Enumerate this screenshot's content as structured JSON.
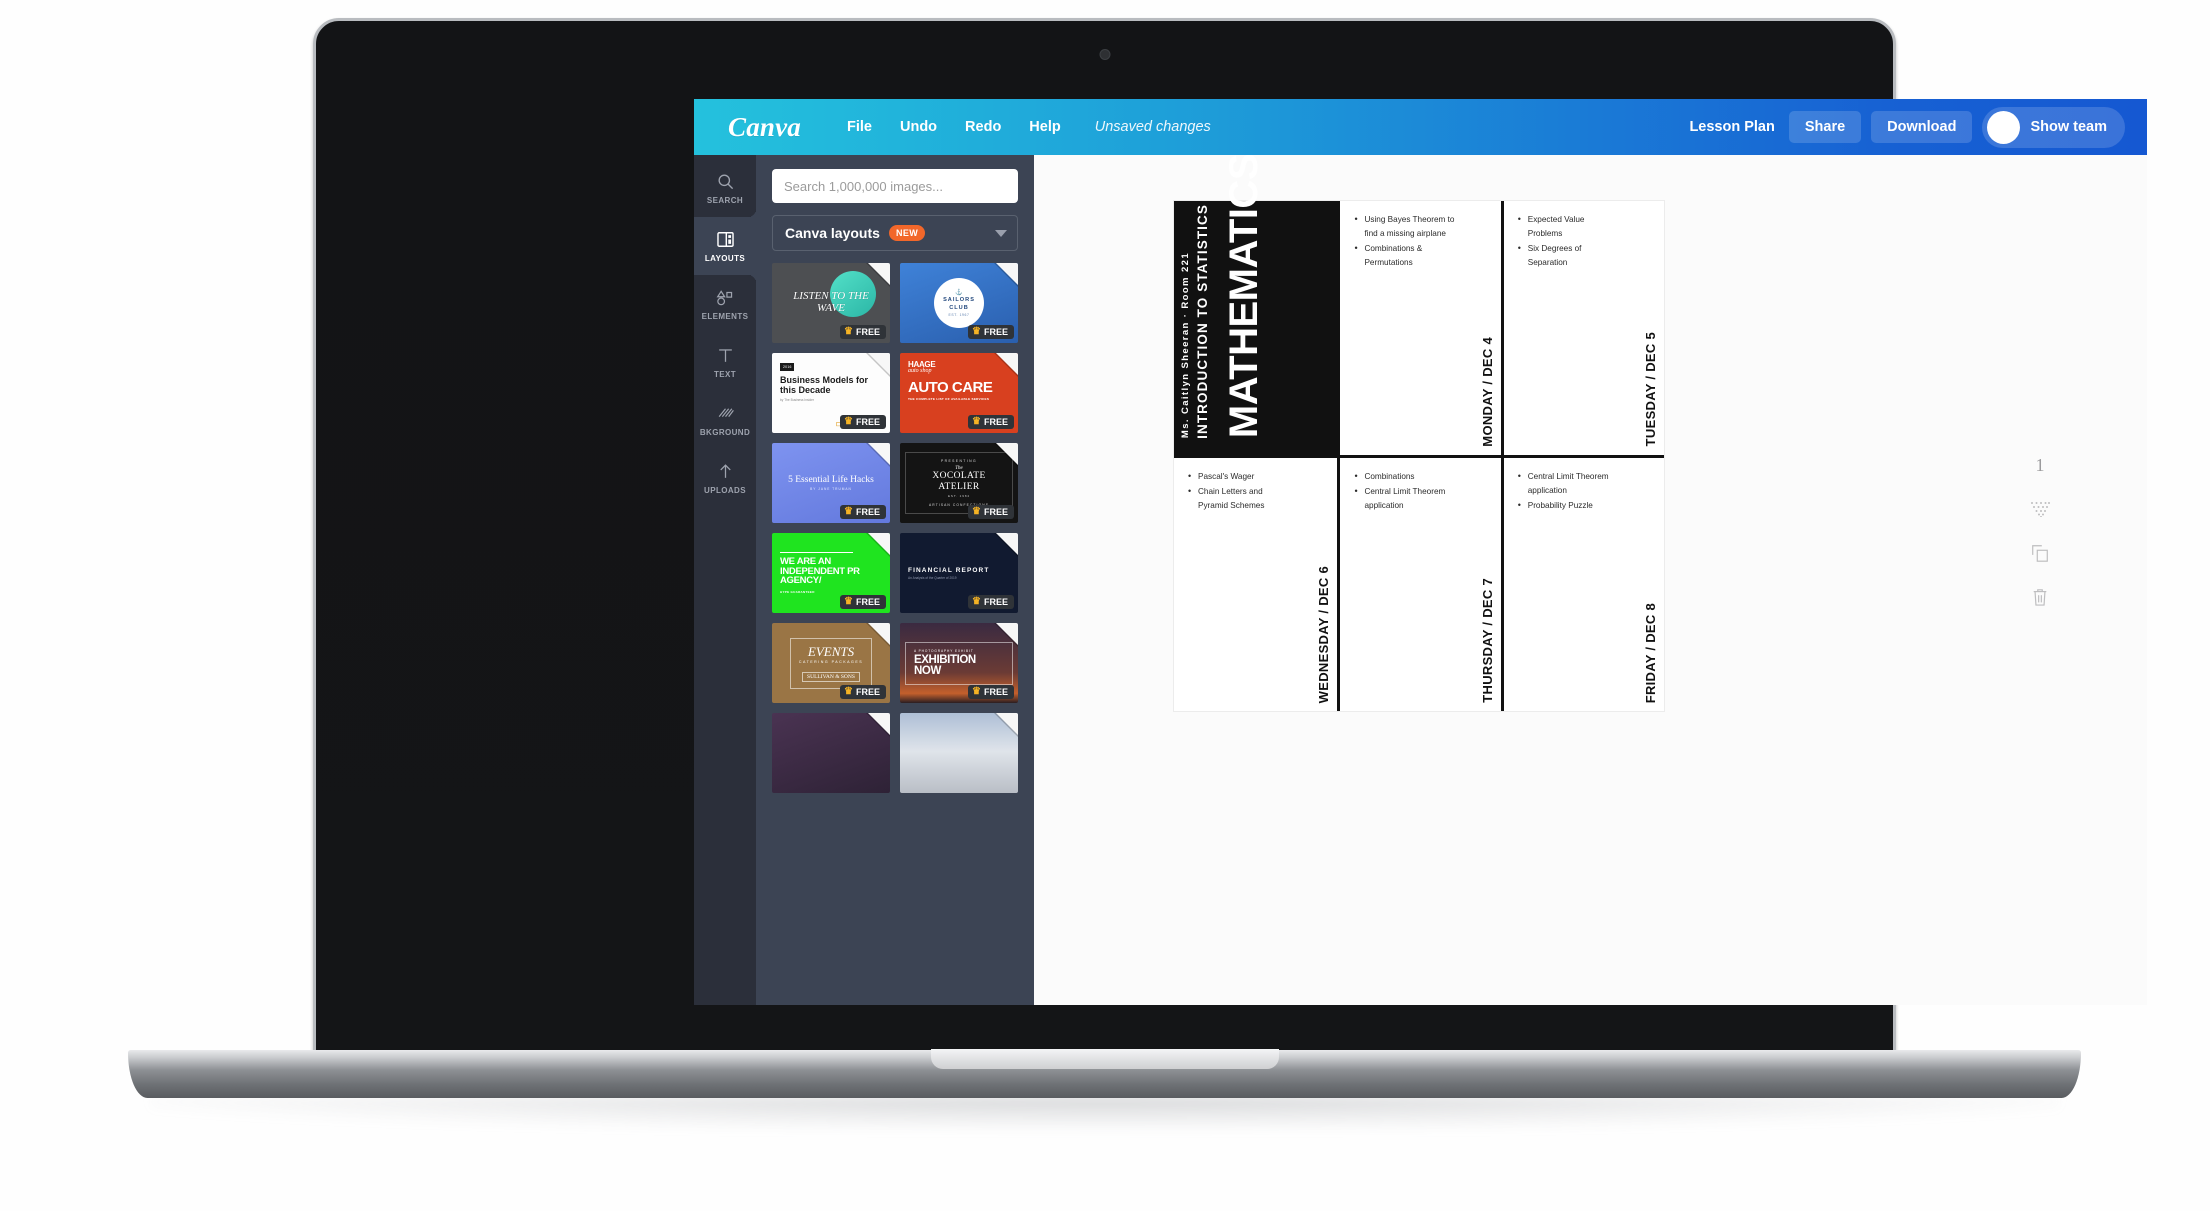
{
  "app": {
    "brand": "Canva"
  },
  "topbar": {
    "menu": [
      {
        "label": "File",
        "name": "menu-file"
      },
      {
        "label": "Undo",
        "name": "menu-undo"
      },
      {
        "label": "Redo",
        "name": "menu-redo"
      },
      {
        "label": "Help",
        "name": "menu-help"
      }
    ],
    "status": "Unsaved changes",
    "doc_title": "Lesson Plan",
    "share_label": "Share",
    "download_label": "Download",
    "team_label": "Show team",
    "gradient_start": "#24c1dd",
    "gradient_end": "#1558d2"
  },
  "rail": {
    "items": [
      {
        "label": "SEARCH",
        "icon": "search-icon",
        "active": false
      },
      {
        "label": "LAYOUTS",
        "icon": "layouts-icon",
        "active": true
      },
      {
        "label": "ELEMENTS",
        "icon": "elements-icon",
        "active": false
      },
      {
        "label": "TEXT",
        "icon": "text-icon",
        "active": false
      },
      {
        "label": "BKGROUND",
        "icon": "background-icon",
        "active": false
      },
      {
        "label": "UPLOADS",
        "icon": "upload-icon",
        "active": false
      }
    ]
  },
  "panel": {
    "search_placeholder": "Search 1,000,000 images...",
    "search_value": "",
    "dropdown_label": "Canva layouts",
    "dropdown_badge": "NEW",
    "free_label": "FREE",
    "templates": [
      {
        "title": "LISTEN TO THE WAVE",
        "sub": "",
        "free": true,
        "bg": "#4d4f52",
        "fg": "#ffffff",
        "style": "wave"
      },
      {
        "title": "SAILORS CLUB",
        "sub": "EST. 1967",
        "free": true,
        "bg": "#2f6ec4",
        "fg": "#ffffff",
        "style": "sailors"
      },
      {
        "title": "Business Models for this Decade",
        "sub": "by The Business Insider",
        "free": true,
        "bg": "#ffffff",
        "fg": "#1a1a1a",
        "style": "business"
      },
      {
        "title": "AUTO CARE",
        "sub": "THE COMPLETE LIST OF AVAILABLE SERVICES",
        "free": true,
        "bg": "#d8401f",
        "fg": "#ffffff",
        "style": "auto",
        "brand": "HAAGE",
        "brand_sub": "auto shop"
      },
      {
        "title": "5 Essential Life Hacks",
        "sub": "BY JANE TRUMAN",
        "free": true,
        "bg": "#6f86e8",
        "fg": "#ffffff",
        "style": "hacks"
      },
      {
        "title": "XOCOLATE ATELIER",
        "sub": "ARTISAN CONFECTIONS",
        "free": true,
        "bg": "#141414",
        "fg": "#ffffff",
        "style": "xocolate",
        "kicker": "PRESENTING",
        "the": "The",
        "est": "EST. 1984"
      },
      {
        "title": "WE ARE AN INDEPENDENT PR AGENCY/",
        "sub": "HYPE GUARANTEED",
        "free": true,
        "bg": "#1fe41f",
        "fg": "#ffffff",
        "style": "pr"
      },
      {
        "title": "FINANCIAL REPORT",
        "sub": "An Analysis of the Quarter of 2019",
        "free": true,
        "bg": "#111a30",
        "fg": "#ffffff",
        "style": "financial"
      },
      {
        "title": "EVENTS",
        "sub": "CATERING PACKAGES",
        "free": true,
        "bg": "#9a7545",
        "fg": "#ffffff",
        "style": "events",
        "footer": "SULLIVAN & SONS"
      },
      {
        "title": "EXHIBITION NOW",
        "sub": "A PHOTOGRAPHY EXHIBIT",
        "free": true,
        "bg": "#3a2a36",
        "fg": "#ffffff",
        "style": "exhibition"
      },
      {
        "title": "",
        "sub": "",
        "free": false,
        "bg": "#3b2b43",
        "fg": "#ffffff",
        "style": "plain"
      },
      {
        "title": "",
        "sub": "",
        "free": false,
        "bg": "#c9ced8",
        "fg": "#ffffff",
        "style": "clouds"
      }
    ]
  },
  "document": {
    "title": "MATHEMATICS",
    "subtitle": "INTRODUCTION TO STATISTICS",
    "meta": "Ms. Caitlyn Sheeran  ·  Room 221",
    "days": [
      {
        "label": "MONDAY / DEC 4",
        "items": [
          "Using Bayes Theorem to find a missing airplane",
          "Combinations & Permutations"
        ]
      },
      {
        "label": "TUESDAY / DEC 5",
        "items": [
          "Expected Value Problems",
          "Six Degrees of Separation"
        ]
      },
      {
        "label": "WEDNESDAY / DEC 6",
        "items": [
          "Pascal's Wager",
          "Chain Letters and Pyramid Schemes"
        ]
      },
      {
        "label": "THURSDAY / DEC 7",
        "items": [
          "Combinations",
          "Central Limit Theorem application"
        ]
      },
      {
        "label": "FRIDAY / DEC 8",
        "items": [
          "Central Limit Theorem application",
          "Probability Puzzle"
        ]
      }
    ]
  },
  "right_tools": {
    "page_number": "1",
    "tools": [
      {
        "name": "page-number",
        "icon": "page-number"
      },
      {
        "name": "grid-dots-icon",
        "icon": "grid-dots-icon"
      },
      {
        "name": "duplicate-icon",
        "icon": "duplicate-icon"
      },
      {
        "name": "trash-icon",
        "icon": "trash-icon"
      }
    ]
  }
}
